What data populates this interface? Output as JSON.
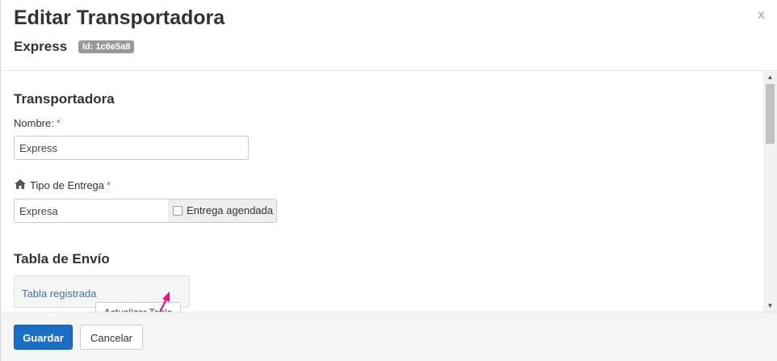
{
  "header": {
    "title": "Editar Transportadora",
    "close_label": "x",
    "subtitle": "Express",
    "id_badge": "Id: 1c6e5a8"
  },
  "form": {
    "section_title": "Transportadora",
    "nombre_label": "Nombre:",
    "nombre_required": "*",
    "nombre_value": "Express",
    "tipo_label": "Tipo de Entrega",
    "tipo_required": "*",
    "tipo_value": "Expresa",
    "tipo_icon": "home-icon",
    "checkbox_label": "Entrega agendada",
    "checkbox_checked": false
  },
  "tabla": {
    "section_title": "Tabla de Envío",
    "link_label": "Tabla registrada",
    "update_button": "Actualizar Tabla"
  },
  "footer": {
    "save_label": "Guardar",
    "cancel_label": "Cancelar"
  },
  "annotation": {
    "arrow_color": "#e8197b"
  },
  "colors": {
    "primary": "#1a6ec4",
    "link": "#337ab7",
    "required": "#d9534f",
    "badge": "#999999"
  }
}
